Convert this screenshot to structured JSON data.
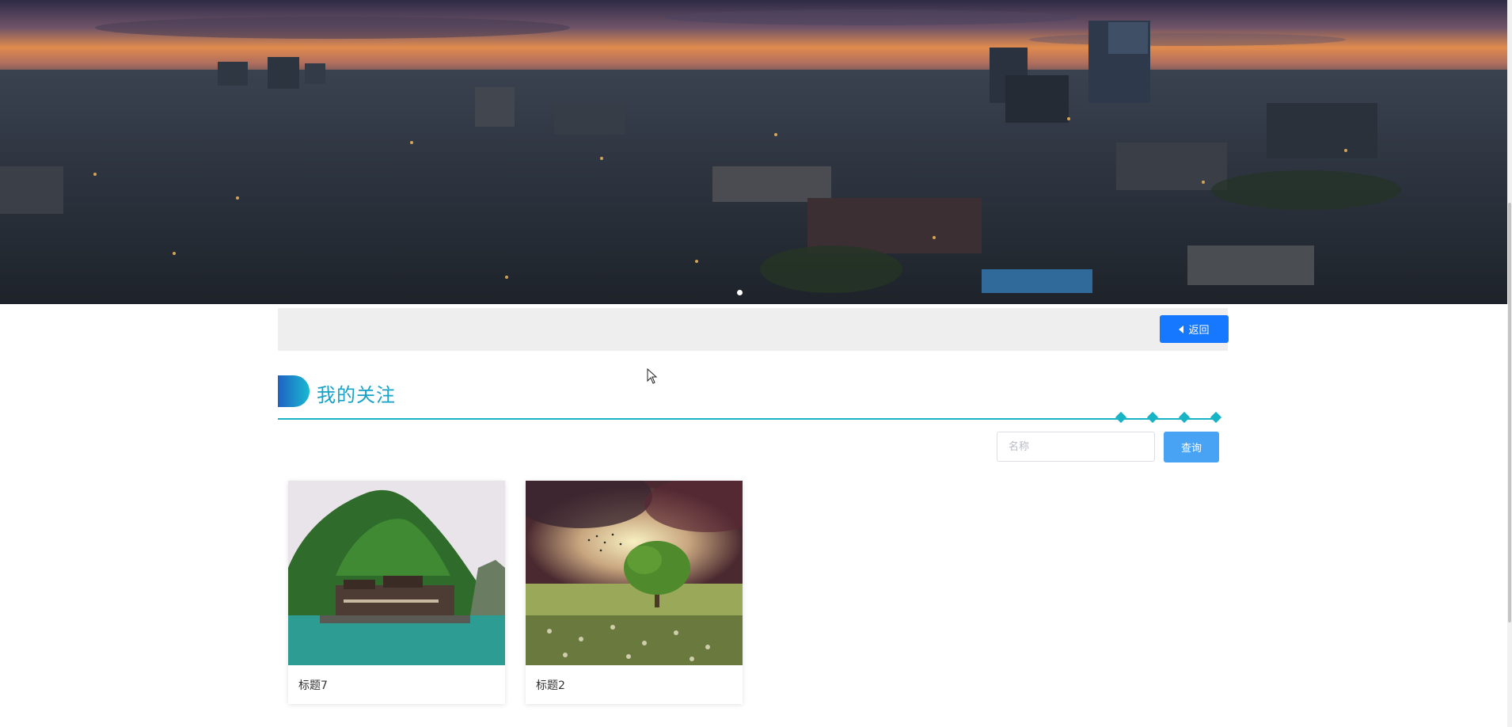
{
  "banner": {
    "image": "city-skyline-sunset",
    "carousel_indicators": 1
  },
  "toolbar": {
    "back_label": "返回",
    "back_icon": "caret-left-icon"
  },
  "section": {
    "title": "我的关注",
    "accent_color": "#18b3c5"
  },
  "search": {
    "placeholder": "名称",
    "value": "",
    "button_label": "查询"
  },
  "cards": [
    {
      "title": "标题7",
      "image": "mountain-village-river"
    },
    {
      "title": "标题2",
      "image": "lone-tree-field-stormy-sky"
    }
  ],
  "colors": {
    "primary": "#1677ff",
    "search_button": "#48a3f5",
    "heading": "#17a2c7",
    "toolbar_bg": "#eeeeee"
  }
}
